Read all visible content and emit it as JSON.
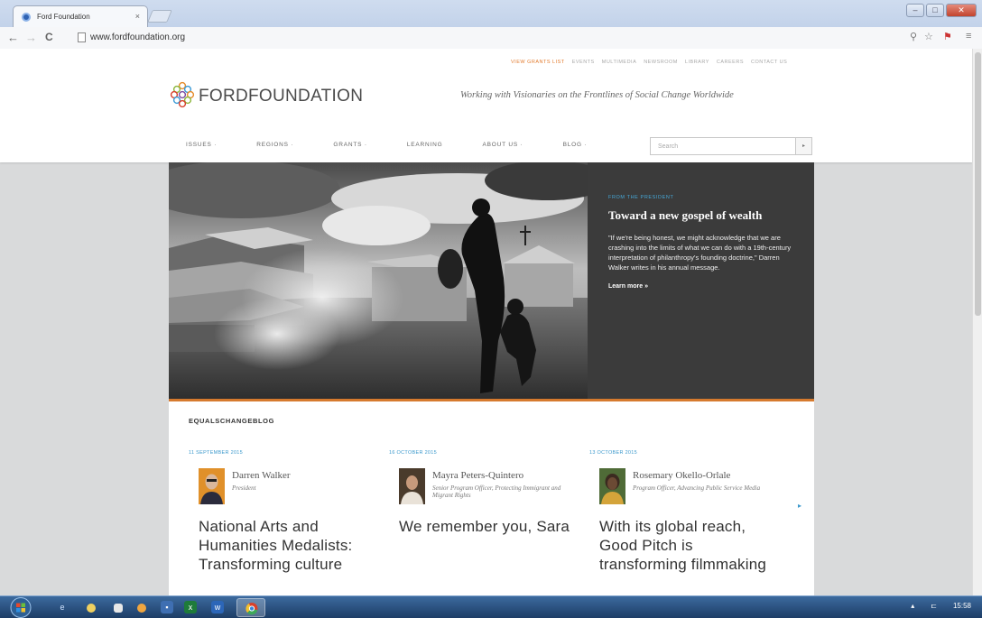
{
  "browser": {
    "tab_title": "Ford Foundation",
    "tab_close": "×",
    "url": "www.fordfoundation.org",
    "back": "←",
    "forward": "→",
    "reload": "C",
    "window_controls": [
      "–",
      "□",
      "✕"
    ]
  },
  "site": {
    "utility_nav": [
      "VIEW GRANTS LIST",
      "EVENTS",
      "MULTIMEDIA",
      "NEWSROOM",
      "LIBRARY",
      "CAREERS",
      "CONTACT US"
    ],
    "logo_text": "FORDFOUNDATION",
    "tagline": "Working with Visionaries on the Frontlines of Social Change Worldwide",
    "main_nav": [
      "ISSUES ·",
      "REGIONS ·",
      "GRANTS ·",
      "LEARNING",
      "ABOUT US ·",
      "BLOG ·"
    ],
    "search": {
      "placeholder": "Search",
      "button": "▸"
    }
  },
  "hero": {
    "kicker": "FROM THE PRESIDENT",
    "title": "Toward a new gospel of wealth",
    "body": "\"If we're being honest, we might acknowledge that we are crashing into the limits of what we can do with a 19th-century interpretation of philanthropy's founding doctrine,\" Darren Walker writes in his annual message.",
    "link": "Learn more »"
  },
  "blog": {
    "heading": "EQUALSCHANGEBLOG",
    "next": "▸",
    "cards": [
      {
        "date": "11 SEPTEMBER 2015",
        "author": "Darren Walker",
        "role": "President",
        "title": "National Arts and Humanities Medalists: Transforming culture"
      },
      {
        "date": "16 OCTOBER 2015",
        "author": "Mayra Peters-Quintero",
        "role": "Senior Program Officer, Protecting Immigrant and Migrant Rights",
        "title": "We remember you, Sara"
      },
      {
        "date": "13 OCTOBER 2015",
        "author": "Rosemary Okello-Orlale",
        "role": "Program Officer, Advancing Public Service Media",
        "title": "With its global reach, Good Pitch is transforming filmmaking"
      }
    ]
  },
  "taskbar": {
    "tray_time": "15:58",
    "tray_icons": [
      "▴",
      "⊏"
    ]
  }
}
